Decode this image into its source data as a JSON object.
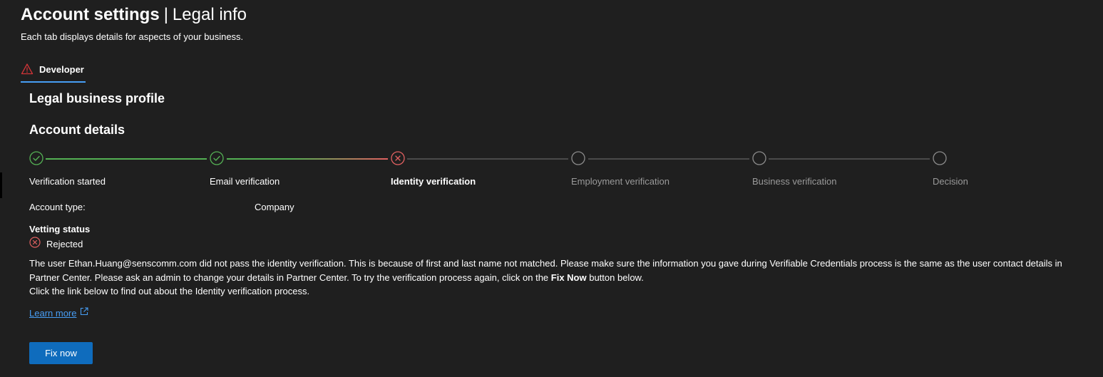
{
  "header": {
    "title_main": "Account settings",
    "title_separator": "|",
    "title_sub": "Legal info",
    "subtitle": "Each tab displays details for aspects of your business."
  },
  "tabs": [
    {
      "label": "Developer",
      "icon": "warning-icon",
      "selected": true
    }
  ],
  "sections": {
    "legal_profile": "Legal business profile",
    "account_details": "Account details"
  },
  "stepper": {
    "steps": [
      {
        "label": "Verification started",
        "state": "done"
      },
      {
        "label": "Email verification",
        "state": "done"
      },
      {
        "label": "Identity verification",
        "state": "failed"
      },
      {
        "label": "Employment verification",
        "state": "pending"
      },
      {
        "label": "Business verification",
        "state": "pending"
      },
      {
        "label": "Decision",
        "state": "pending"
      }
    ]
  },
  "account": {
    "type_label": "Account type:",
    "type_value": "Company"
  },
  "vetting": {
    "label": "Vetting status",
    "status": "Rejected",
    "message_part1": "The user Ethan.Huang@senscomm.com did not pass the identity verification. This is because of first and last name not matched. Please make sure the information you gave during Verifiable Credentials process is the same as the user contact details in Partner Center. Please ask an admin to change your details in Partner Center. To try the verification process again, click on the ",
    "message_bold": "Fix Now",
    "message_part2": " button below.",
    "message_line2": "Click the link below to find out about the Identity verification process."
  },
  "links": {
    "learn_more": "Learn more"
  },
  "actions": {
    "fix_now": "Fix now"
  },
  "colors": {
    "background": "#1f1f1f",
    "accent": "#0f6cbd",
    "link": "#479ef5",
    "success": "#54b054",
    "error": "#d13438",
    "warning": "#d13438",
    "pending": "#8a8a8a"
  }
}
